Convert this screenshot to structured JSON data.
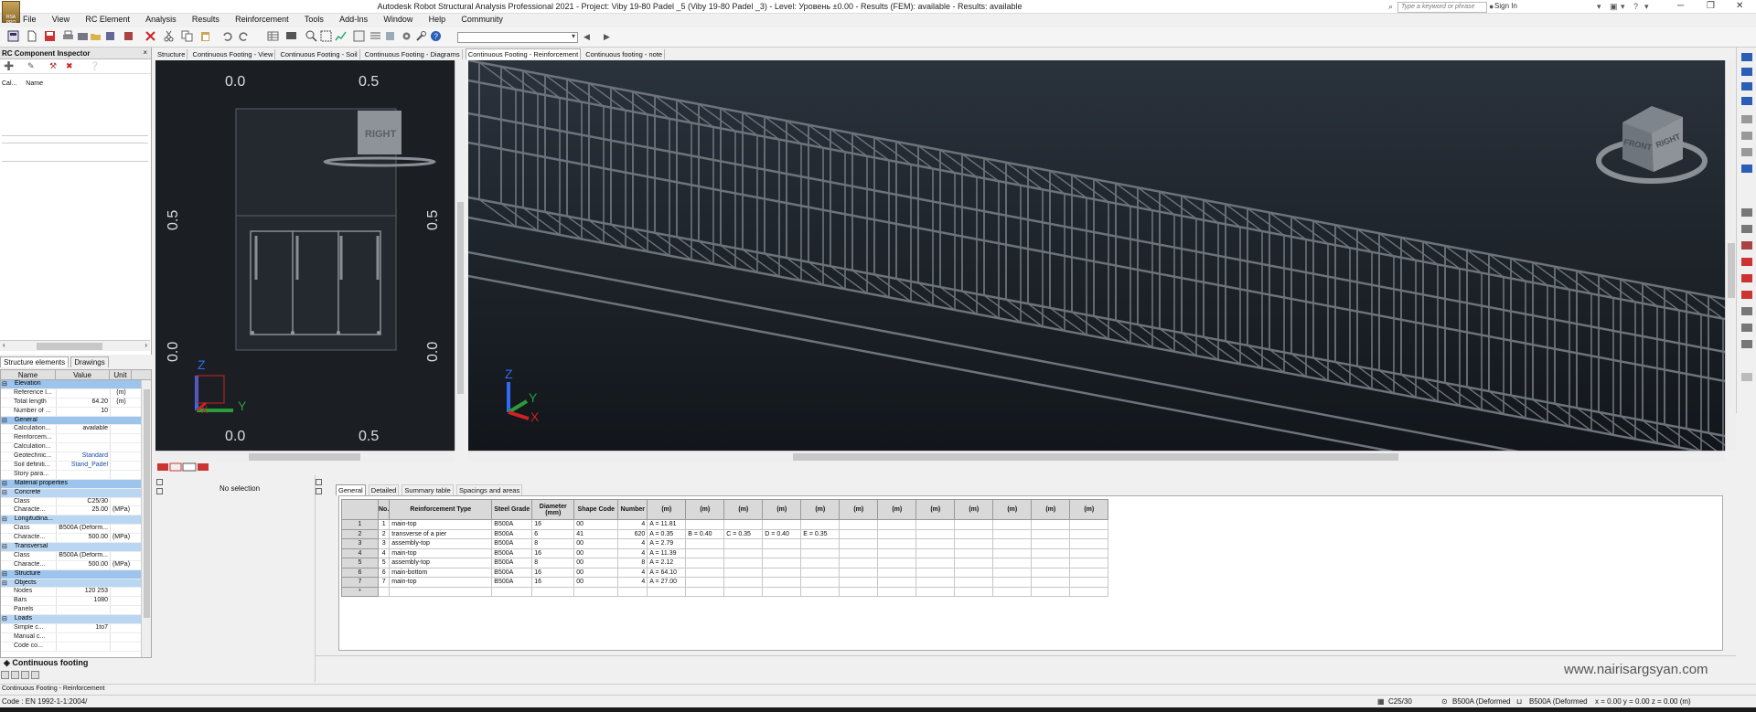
{
  "app": {
    "logo_text": "RSA PRO",
    "title": "Autodesk Robot Structural Analysis Professional 2021 - Project: Viby 19-80 Padel _5 (Viby 19-80 Padel _3) - Level: Уровень ±0.00 - Results (FEM): available - Results: available",
    "search_placeholder": "Type a keyword or phrase",
    "signin_label": "Sign In"
  },
  "menu": [
    "File",
    "View",
    "RC Element",
    "Analysis",
    "Results",
    "Reinforcement",
    "Tools",
    "Add-Ins",
    "Window",
    "Help",
    "Community"
  ],
  "inspector": {
    "title": "RC Component Inspector",
    "close": "×",
    "col_calc": "Cal...",
    "col_name": "Name"
  },
  "left_tabs": [
    "Structure elements",
    "Drawings"
  ],
  "props": {
    "headers": [
      "Name",
      "Value",
      "Unit"
    ],
    "rows": [
      {
        "kind": "sec",
        "name": "Elevation"
      },
      {
        "kind": "row",
        "name": "Reference l...",
        "value": "",
        "unit": "(m)"
      },
      {
        "kind": "row",
        "name": "Total length",
        "value": "64.20",
        "unit": "(m)"
      },
      {
        "kind": "row",
        "name": "Number of ...",
        "value": "10",
        "unit": ""
      },
      {
        "kind": "sec",
        "name": "General"
      },
      {
        "kind": "row",
        "name": "Calculation...",
        "value": "available",
        "unit": ""
      },
      {
        "kind": "row",
        "name": "Reinforcem...",
        "value": "",
        "unit": ""
      },
      {
        "kind": "row",
        "name": "Calculation...",
        "value": "",
        "unit": ""
      },
      {
        "kind": "row",
        "name": "Geotechnic...",
        "value": "Standard",
        "unit": "",
        "blue": true
      },
      {
        "kind": "row",
        "name": "Soil definiti...",
        "value": "Stand_Padel",
        "unit": "",
        "blue": true
      },
      {
        "kind": "row",
        "name": "Story para...",
        "value": "",
        "unit": ""
      },
      {
        "kind": "sec",
        "name": "Material properties"
      },
      {
        "kind": "sub",
        "name": "Concrete"
      },
      {
        "kind": "row",
        "name": "Class",
        "value": "C25/30",
        "unit": ""
      },
      {
        "kind": "row",
        "name": "Characte...",
        "value": "25.00",
        "unit": "(MPa)"
      },
      {
        "kind": "sub",
        "name": "Longitudina..."
      },
      {
        "kind": "row",
        "name": "Class",
        "value": "B500A (Deform...",
        "unit": ""
      },
      {
        "kind": "row",
        "name": "Characte...",
        "value": "500.00",
        "unit": "(MPa)"
      },
      {
        "kind": "sub",
        "name": "Transversal"
      },
      {
        "kind": "row",
        "name": "Class",
        "value": "B500A (Deform...",
        "unit": ""
      },
      {
        "kind": "row",
        "name": "Characte...",
        "value": "500.00",
        "unit": "(MPa)"
      },
      {
        "kind": "sec",
        "name": "Structure"
      },
      {
        "kind": "sub",
        "name": "Objects"
      },
      {
        "kind": "row",
        "name": "Nodes",
        "value": "120 253",
        "unit": ""
      },
      {
        "kind": "row",
        "name": "Bars",
        "value": "1080",
        "unit": ""
      },
      {
        "kind": "row",
        "name": "Panels",
        "value": "",
        "unit": ""
      },
      {
        "kind": "sub",
        "name": "Loads"
      },
      {
        "kind": "row",
        "name": "Simple c...",
        "value": "1to7",
        "unit": ""
      },
      {
        "kind": "row",
        "name": "Manual c...",
        "value": "",
        "unit": ""
      },
      {
        "kind": "row",
        "name": "Code co...",
        "value": "",
        "unit": ""
      }
    ]
  },
  "cf_tab": "Continuous footing",
  "status_window": "Continuous Footing - Reinforcement",
  "status_bar": {
    "code": "Code : EN 1992-1-1:2004/",
    "concrete": "C25/30",
    "steel1": "B500A (Deformed",
    "steel2": "B500A (Deformed",
    "coords": "x = 0.00 y = 0.00 z = 0.00    (m)"
  },
  "doc_tabs": [
    "Structure",
    "Continuous Footing - View",
    "Continuous Footing - Soil",
    "Continuous Footing - Diagrams",
    "Continuous Footing - Reinforcement",
    "Continuous footing - note"
  ],
  "active_doc_tab": 4,
  "viewport1": {
    "ruler_top_left": "0.0",
    "ruler_top_right": "0.5",
    "ruler_bottom_left": "0.0",
    "ruler_bottom_right": "0.5",
    "ruler_left_top": "0.5",
    "ruler_left_bottom": "0.0",
    "ruler_right_top": "0.5",
    "ruler_right_bottom": "0.0",
    "cube_label": "RIGHT",
    "axis_z": "Z",
    "axis_y": "Y",
    "axis_x": "X"
  },
  "viewport2": {
    "cube_front": "FRONT",
    "cube_right": "RIGHT",
    "axis_z": "Z",
    "axis_y": "Y",
    "axis_x": "X"
  },
  "no_selection": "No selection",
  "bottom_tabs": [
    "General",
    "Detailed",
    "Summary table",
    "Spacings and areas"
  ],
  "table": {
    "headers": [
      "",
      "No.",
      "Reinforcement Type",
      "Steel Grade",
      "Diameter (mm)",
      "Shape Code",
      "Number",
      "(m)",
      "(m)",
      "(m)",
      "(m)",
      "(m)",
      "(m)",
      "(m)",
      "(m)",
      "(m)",
      "(m)",
      "(m)",
      "(m)"
    ],
    "rows": [
      [
        "1",
        "1",
        "main-top",
        "B500A",
        "16",
        "00",
        "4",
        "A = 11.81",
        "",
        "",
        "",
        "",
        "",
        "",
        "",
        "",
        "",
        "",
        ""
      ],
      [
        "2",
        "2",
        "transverse of a pier",
        "B500A",
        "6",
        "41",
        "620",
        "A = 0.35",
        "B = 0.40",
        "C = 0.35",
        "D = 0.40",
        "E = 0.35",
        "",
        "",
        "",
        "",
        "",
        "",
        ""
      ],
      [
        "3",
        "3",
        "assembly-top",
        "B500A",
        "8",
        "00",
        "4",
        "A = 2.79",
        "",
        "",
        "",
        "",
        "",
        "",
        "",
        "",
        "",
        "",
        ""
      ],
      [
        "4",
        "4",
        "main-top",
        "B500A",
        "16",
        "00",
        "4",
        "A = 11.39",
        "",
        "",
        "",
        "",
        "",
        "",
        "",
        "",
        "",
        "",
        ""
      ],
      [
        "5",
        "5",
        "assembly-top",
        "B500A",
        "8",
        "00",
        "8",
        "A = 2.12",
        "",
        "",
        "",
        "",
        "",
        "",
        "",
        "",
        "",
        "",
        ""
      ],
      [
        "6",
        "6",
        "main-bottom",
        "B500A",
        "16",
        "00",
        "4",
        "A = 64.10",
        "",
        "",
        "",
        "",
        "",
        "",
        "",
        "",
        "",
        "",
        ""
      ],
      [
        "7",
        "7",
        "main-top",
        "B500A",
        "16",
        "00",
        "4",
        "A = 27.00",
        "",
        "",
        "",
        "",
        "",
        "",
        "",
        "",
        "",
        "",
        ""
      ],
      [
        "*",
        "",
        "",
        "",
        "",
        "",
        "",
        "",
        "",
        "",
        "",
        "",
        "",
        "",
        "",
        "",
        "",
        "",
        ""
      ]
    ]
  },
  "watermark": "www.nairisargsyan.com",
  "colors": {
    "section_bg": "#9cc4ec",
    "viewport_bg": "#1b1f24",
    "rebar": "#7a7f86"
  }
}
